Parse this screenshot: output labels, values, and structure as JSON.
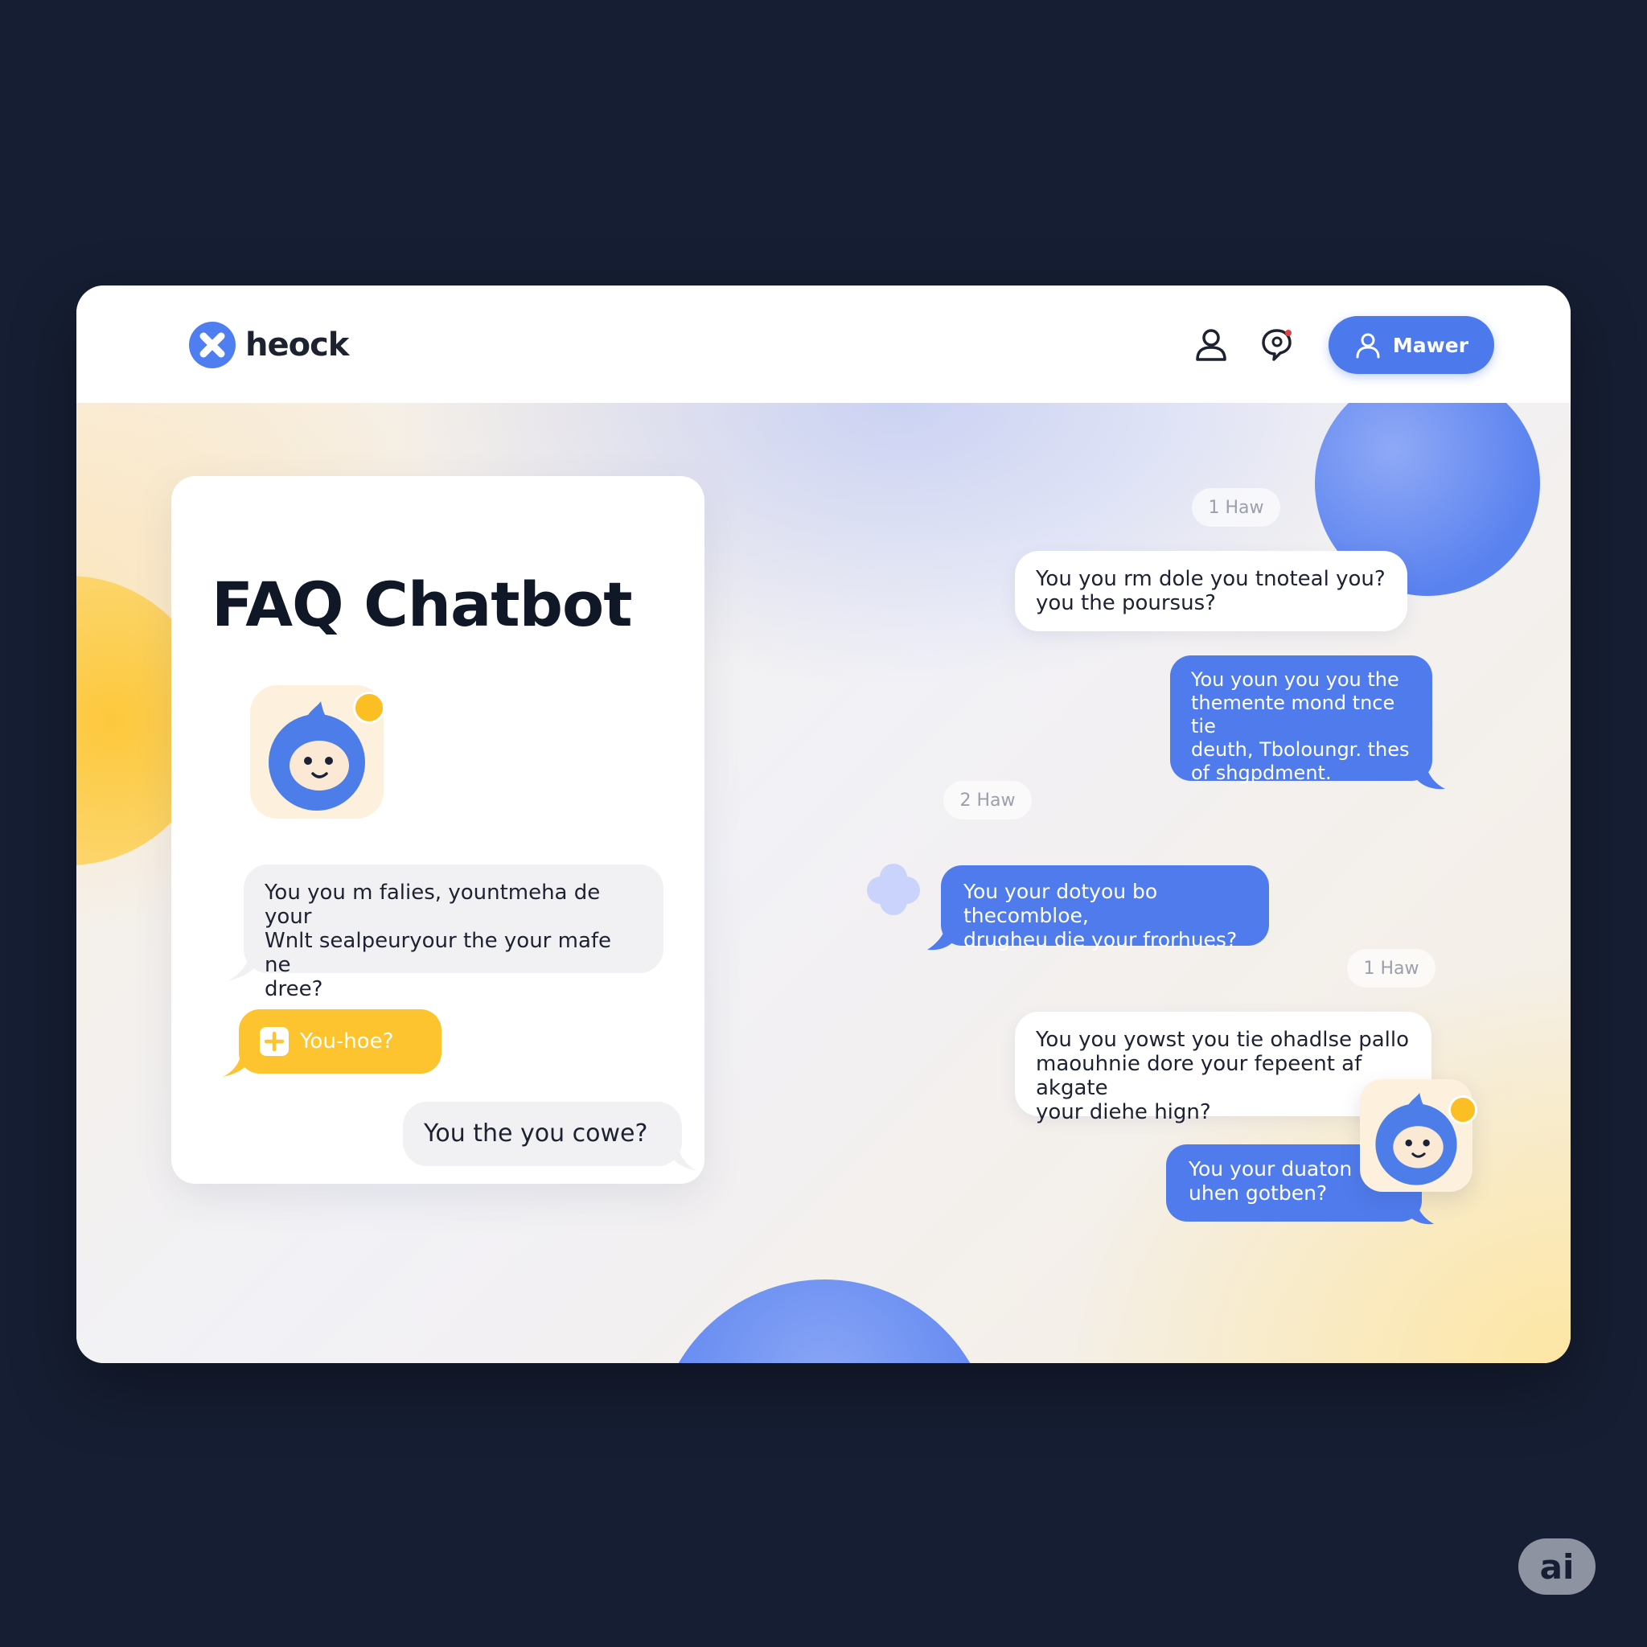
{
  "header": {
    "brand_name": "heock",
    "logo_icon": "x-logo-icon",
    "user_icon": "user-icon",
    "chat_icon": "chat-notification-icon",
    "manager_button": "Mawer"
  },
  "card": {
    "title": "FAQ Chatbot",
    "bubbles": [
      "You you m falies, yountmeha de your\nWnlt sealpeuryour the your mafe ne\ndree?",
      "You-hoe?",
      "You the you cowe?"
    ]
  },
  "chat": {
    "timestamps": [
      "1 Haw",
      "2 Haw",
      "1 Haw"
    ],
    "messages": [
      "You you rm dole you tnoteal you?\nyou the poursus?",
      "You youn you you the\nthemente mond tnce tie\ndeuth, Tboloungr. thes\nof shgpdment.",
      "You your dotyou bo thecombloe,\ndrugheu die your frorhues?",
      "You you yowst you tie ohadlse pallo\nmaouhnie dore your fepeent af akgate\nyour diehe hign?",
      "You your duaton\nuhen gotben?"
    ]
  },
  "badge": {
    "label": "ai"
  },
  "colors": {
    "accent_blue": "#4f7bec",
    "accent_yellow": "#fdc42f",
    "background": "#161e33"
  }
}
